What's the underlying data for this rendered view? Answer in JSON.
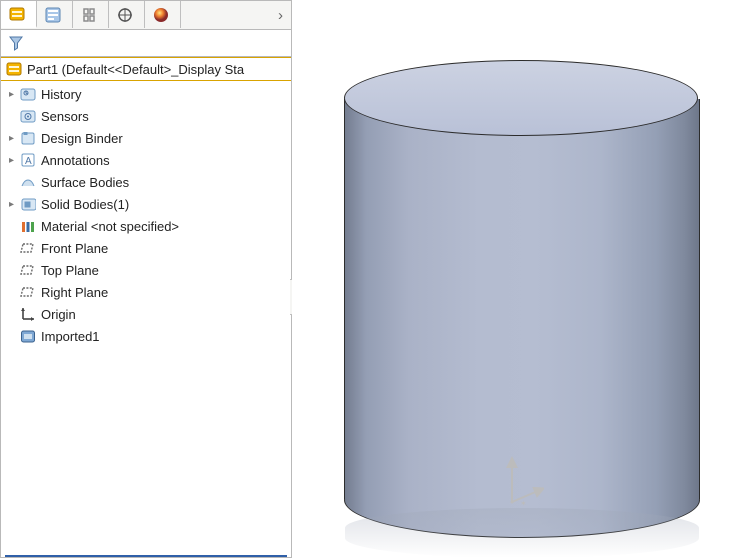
{
  "tabs": {
    "overflow_glyph": "›"
  },
  "root": {
    "label": "Part1  (Default<<Default>_Display Sta"
  },
  "tree": [
    {
      "label": "History",
      "expandable": true,
      "icon": "history"
    },
    {
      "label": "Sensors",
      "expandable": false,
      "icon": "sensors"
    },
    {
      "label": "Design Binder",
      "expandable": true,
      "icon": "binder"
    },
    {
      "label": "Annotations",
      "expandable": true,
      "icon": "annotations"
    },
    {
      "label": "Surface Bodies",
      "expandable": false,
      "icon": "surface"
    },
    {
      "label": "Solid Bodies(1)",
      "expandable": true,
      "icon": "solid"
    },
    {
      "label": "Material <not specified>",
      "expandable": false,
      "icon": "material"
    },
    {
      "label": "Front Plane",
      "expandable": false,
      "icon": "plane"
    },
    {
      "label": "Top Plane",
      "expandable": false,
      "icon": "plane"
    },
    {
      "label": "Right Plane",
      "expandable": false,
      "icon": "plane"
    },
    {
      "label": "Origin",
      "expandable": false,
      "icon": "origin"
    },
    {
      "label": "Imported1",
      "expandable": false,
      "icon": "imported"
    }
  ]
}
